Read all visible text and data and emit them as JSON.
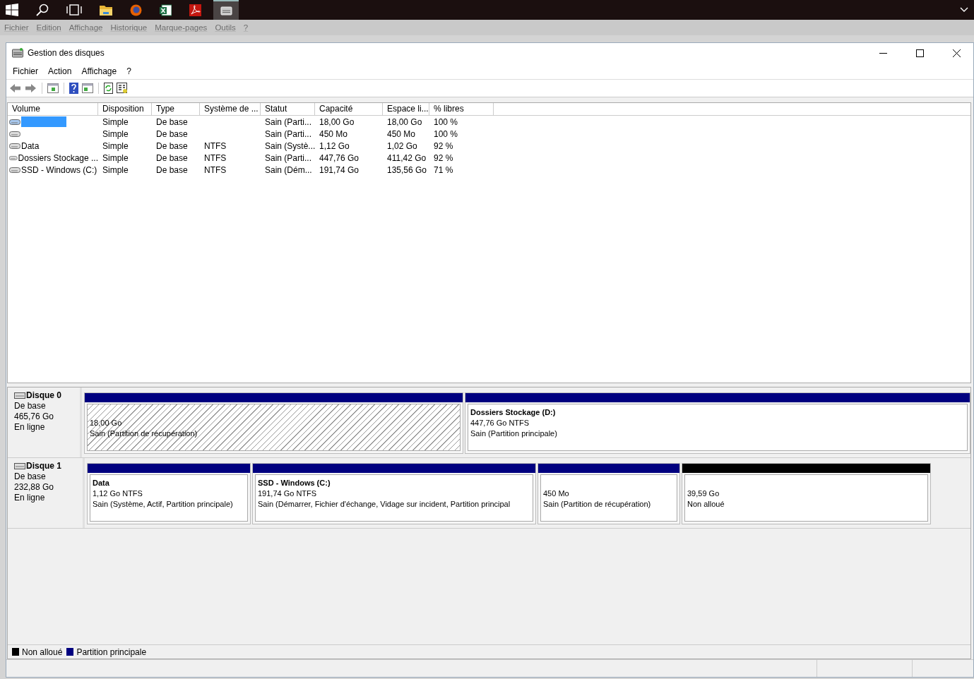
{
  "browser_menu": [
    "Fichier",
    "Edition",
    "Affichage",
    "Historique",
    "Marque-pages",
    "Outils",
    "?"
  ],
  "window": {
    "title": "Gestion des disques"
  },
  "menu": [
    "Fichier",
    "Action",
    "Affichage",
    "?"
  ],
  "table": {
    "columns": [
      "Volume",
      "Disposition",
      "Type",
      "Système de ...",
      "Statut",
      "Capacité",
      "Espace li...",
      "% libres"
    ],
    "rows": [
      {
        "selected": true,
        "cells": [
          "",
          "Simple",
          "De base",
          "",
          "Sain (Parti...",
          "18,00 Go",
          "18,00 Go",
          "100 %"
        ]
      },
      {
        "selected": false,
        "cells": [
          "",
          "Simple",
          "De base",
          "",
          "Sain (Parti...",
          "450 Mo",
          "450 Mo",
          "100 %"
        ]
      },
      {
        "selected": false,
        "cells": [
          "Data",
          "Simple",
          "De base",
          "NTFS",
          "Sain (Systè...",
          "1,12 Go",
          "1,02 Go",
          "92 %"
        ]
      },
      {
        "selected": false,
        "cells": [
          "Dossiers Stockage ...",
          "Simple",
          "De base",
          "NTFS",
          "Sain (Parti...",
          "447,76 Go",
          "411,42 Go",
          "92 %"
        ]
      },
      {
        "selected": false,
        "cells": [
          "SSD - Windows (C:)",
          "Simple",
          "De base",
          "NTFS",
          "Sain (Dém...",
          "191,74 Go",
          "135,56 Go",
          "71 %"
        ]
      }
    ]
  },
  "disks": [
    {
      "name": "Disque 0",
      "type": "De base",
      "size": "465,76 Go",
      "status": "En ligne",
      "partitions": [
        {
          "selected": true,
          "color": "#00007f",
          "size": "18,00 Go",
          "status": "Sain (Partition de récupération)"
        },
        {
          "selected": false,
          "color": "#00007f",
          "name": "Dossiers Stockage  (D:)",
          "size": "447,76 Go NTFS",
          "status": "Sain (Partition principale)"
        }
      ]
    },
    {
      "name": "Disque 1",
      "type": "De base",
      "size": "232,88 Go",
      "status": "En ligne",
      "partitions": [
        {
          "selected": false,
          "color": "#00007f",
          "name": "Data",
          "size": "1,12 Go NTFS",
          "status": "Sain (Système, Actif, Partition principale)"
        },
        {
          "selected": false,
          "color": "#00007f",
          "name": "SSD - Windows  (C:)",
          "size": "191,74 Go NTFS",
          "status": "Sain (Démarrer, Fichier d'échange, Vidage sur incident, Partition principal"
        },
        {
          "selected": false,
          "color": "#00007f",
          "size": "450 Mo",
          "status": "Sain (Partition de récupération)"
        },
        {
          "selected": false,
          "color": "#000000",
          "size": "39,59 Go",
          "status": "Non alloué"
        }
      ]
    }
  ],
  "legend": [
    {
      "label": "Non alloué",
      "color": "#000000"
    },
    {
      "label": "Partition principale",
      "color": "#00007f"
    }
  ]
}
